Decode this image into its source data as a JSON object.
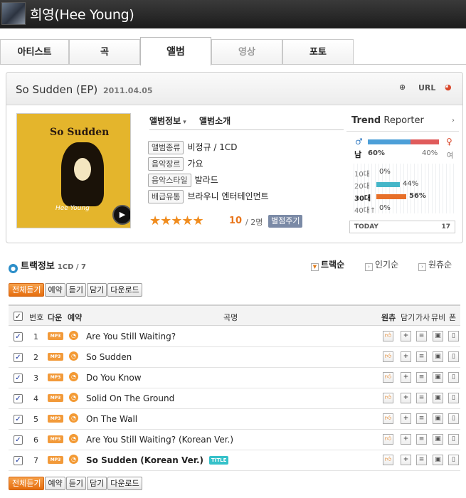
{
  "header": {
    "artist_title": "희영(Hee Young)"
  },
  "tabs": [
    {
      "label": "아티스트"
    },
    {
      "label": "곡"
    },
    {
      "label": "앨범"
    },
    {
      "label": "영상"
    },
    {
      "label": "포토"
    }
  ],
  "album": {
    "name": "So Sudden (EP)",
    "release_date": "2011.04.05",
    "url_label": "URL",
    "cover_title": "So Sudden",
    "cover_signature": "Hee Young",
    "tab_info": "앨범정보",
    "tab_intro": "앨범소개",
    "info": [
      {
        "label": "앨범종류",
        "value": "비정규 / 1CD"
      },
      {
        "label": "음악장르",
        "value": "가요"
      },
      {
        "label": "음악스타일",
        "value": "발라드"
      },
      {
        "label": "배급유통",
        "value": "브라우니 엔터테인먼트"
      }
    ],
    "rating": {
      "stars": 5,
      "score": "10",
      "count": "/ 2명",
      "button": "별점주기"
    }
  },
  "trend": {
    "title_bold": "Trend",
    "title_rest": " Reporter",
    "male_label": "남",
    "female_label": "여",
    "male_pct": "60%",
    "female_pct": "40%",
    "male_value": 60,
    "ages": [
      {
        "label": "10대",
        "pct": "0%",
        "value": 0
      },
      {
        "label": "20대",
        "pct": "44%",
        "value": 44
      },
      {
        "label": "30대",
        "pct": "56%",
        "value": 56
      },
      {
        "label": "40대↑",
        "pct": "0%",
        "value": 0
      }
    ],
    "today_label": "TODAY",
    "today_value": "17"
  },
  "tracks_section": {
    "title": "트랙정보",
    "sub": "1CD / 7",
    "sort_options": [
      "트랙순",
      "인기순",
      "원츄순"
    ]
  },
  "buttons": [
    "전체듣기",
    "예약",
    "듣기",
    "담기",
    "다운로드"
  ],
  "columns": {
    "no": "번호",
    "down": "다운",
    "reserve": "예약",
    "song": "곡명",
    "wanchu": "원츄",
    "add": "담기",
    "lyrics": "가사",
    "mv": "뮤비",
    "phone": "폰"
  },
  "tracks": [
    {
      "no": "1",
      "title": "Are You Still Waiting?",
      "badge": ""
    },
    {
      "no": "2",
      "title": "So Sudden",
      "badge": ""
    },
    {
      "no": "3",
      "title": "Do You Know",
      "badge": ""
    },
    {
      "no": "4",
      "title": "Solid On The Ground",
      "badge": ""
    },
    {
      "no": "5",
      "title": "On The Wall",
      "badge": ""
    },
    {
      "no": "6",
      "title": "Are You Still Waiting? (Korean Ver.)",
      "badge": ""
    },
    {
      "no": "7",
      "title": "So Sudden (Korean Ver.)",
      "badge": "TITLE"
    }
  ],
  "icons": {
    "mp3": "MP3",
    "colors": {
      "accent": "#e8751b",
      "title_badge": "#35c1c9"
    }
  }
}
